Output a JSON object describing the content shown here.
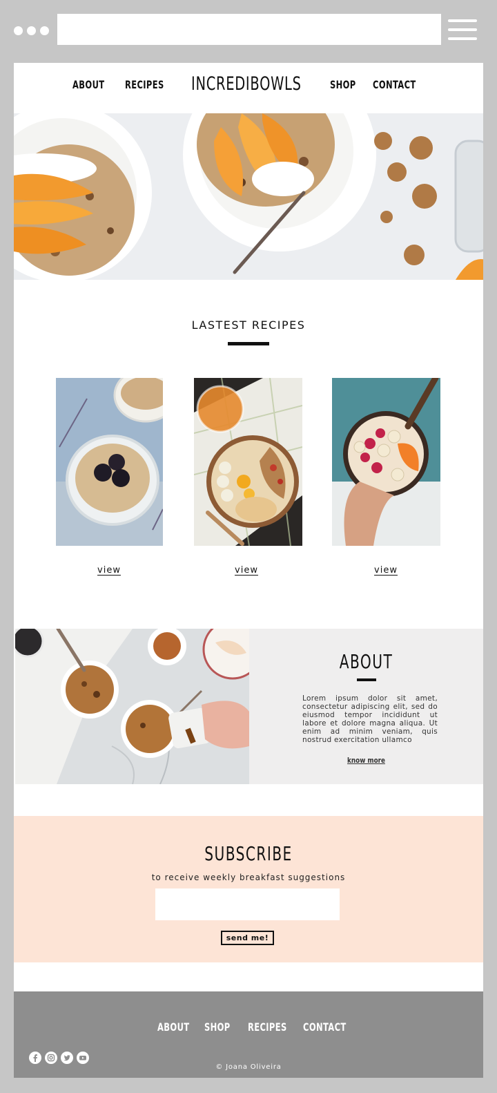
{
  "browser": {
    "address_value": "",
    "menu_icon": "hamburger-icon"
  },
  "nav": {
    "about": "ABOUT",
    "recipes": "RECIPES",
    "brand": "INCREDIBOWLS",
    "shop": "SHOP",
    "contact": "CONTACT"
  },
  "latest": {
    "title": "LASTEST RECIPES",
    "items": [
      {
        "link": "view"
      },
      {
        "link": "view"
      },
      {
        "link": "view"
      }
    ]
  },
  "about": {
    "title": "ABOUT",
    "body": "Lorem ipsum dolor sit amet, consectetur adipiscing elit, sed do eiusmod tempor incididunt ut labore et dolore magna aliqua. Ut enim ad minim veniam, quis nostrud exercitation ullamco",
    "link": "know more"
  },
  "subscribe": {
    "title": "SUBSCRIBE",
    "subtitle": "to receive weekly breakfast suggestions",
    "input_value": "",
    "button": "send me!"
  },
  "footer": {
    "links": [
      "ABOUT",
      "SHOP",
      "RECIPES",
      "CONTACT"
    ],
    "social_icons": [
      "facebook-icon",
      "instagram-icon",
      "twitter-icon",
      "youtube-icon"
    ],
    "copyright": "© Joana Oliveira"
  },
  "colors": {
    "frame": "#c6c6c6",
    "subscribe_bg": "#fde4d6",
    "about_bg": "#efeeee",
    "footer_bg": "#8e8e8e",
    "text": "#111111"
  }
}
